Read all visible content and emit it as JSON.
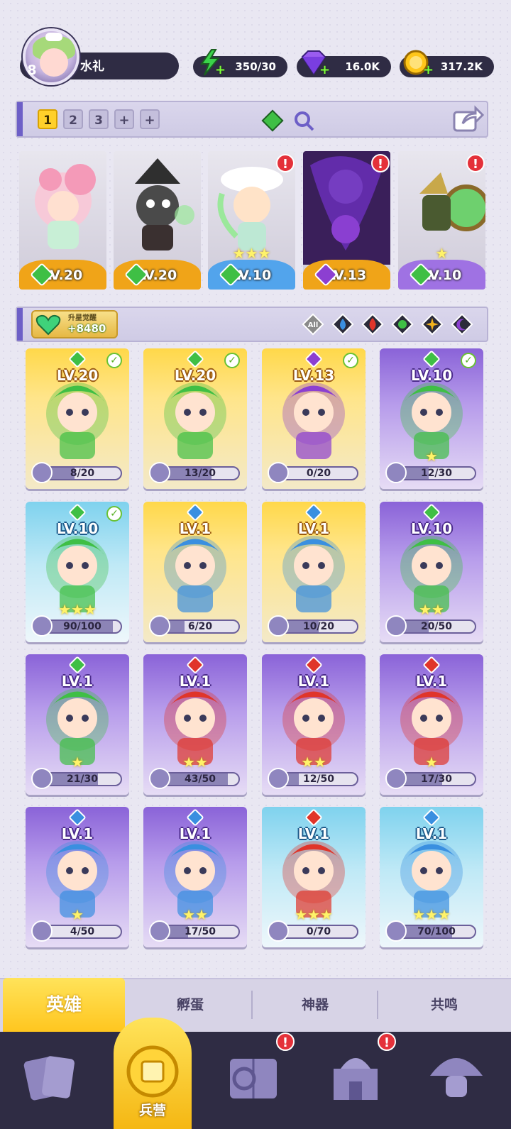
{
  "player": {
    "level": "8",
    "name": "水礼"
  },
  "resources": {
    "energy": "350/30",
    "gems": "16.0K",
    "gold": "317.2K"
  },
  "team": {
    "slots": [
      "1",
      "2",
      "3",
      "+",
      "+"
    ],
    "active_slot": "1",
    "heroes": [
      {
        "level": "LV.20",
        "element": "nature",
        "bar": "orange"
      },
      {
        "level": "LV.20",
        "element": "nature",
        "bar": "orange"
      },
      {
        "level": "LV.10",
        "element": "nature",
        "bar": "blue",
        "stars": 3,
        "alert": "!"
      },
      {
        "level": "LV.13",
        "element": "dark",
        "bar": "orange",
        "alert": "!"
      },
      {
        "level": "LV.10",
        "element": "nature",
        "bar": "purple",
        "stars": 1,
        "alert": "!"
      }
    ]
  },
  "filter": {
    "awaken_title": "升星觉醒",
    "awaken_value": "+8480",
    "chips": [
      "All",
      "water",
      "fire",
      "nature",
      "light",
      "dark"
    ],
    "all_label": "All"
  },
  "colors": {
    "nature": "#3fbf45",
    "water": "#3a8fe0",
    "fire": "#e0352a",
    "light": "#f2b21c",
    "dark": "#8c3fd1",
    "accent": "#ffcc22",
    "nav_bg": "#2f2c44"
  },
  "heroes": [
    {
      "level": "LV.20",
      "element": "nature",
      "frame": "gold",
      "progress": "8/20",
      "fill": 0.4,
      "owned": true,
      "stars": 0
    },
    {
      "level": "LV.20",
      "element": "nature",
      "frame": "gold",
      "progress": "13/20",
      "fill": 0.65,
      "owned": true,
      "stars": 0
    },
    {
      "level": "LV.13",
      "element": "dark",
      "frame": "gold",
      "progress": "0/20",
      "fill": 0.0,
      "owned": true,
      "stars": 0
    },
    {
      "level": "LV.10",
      "element": "nature",
      "frame": "purple",
      "progress": "12/30",
      "fill": 0.4,
      "owned": true,
      "stars": 1
    },
    {
      "level": "LV.10",
      "element": "nature",
      "frame": "cyan",
      "progress": "90/100",
      "fill": 0.9,
      "owned": true,
      "stars": 3
    },
    {
      "level": "LV.1",
      "element": "water",
      "frame": "gold",
      "progress": "6/20",
      "fill": 0.3,
      "owned": false,
      "stars": 0
    },
    {
      "level": "LV.1",
      "element": "water",
      "frame": "gold",
      "progress": "10/20",
      "fill": 0.5,
      "owned": false,
      "stars": 0
    },
    {
      "level": "LV.10",
      "element": "nature",
      "frame": "purple",
      "progress": "20/50",
      "fill": 0.4,
      "owned": false,
      "stars": 2
    },
    {
      "level": "LV.1",
      "element": "nature",
      "frame": "purple",
      "progress": "21/30",
      "fill": 0.7,
      "owned": false,
      "stars": 1
    },
    {
      "level": "LV.1",
      "element": "fire",
      "frame": "purple",
      "progress": "43/50",
      "fill": 0.86,
      "owned": false,
      "stars": 2
    },
    {
      "level": "LV.1",
      "element": "fire",
      "frame": "purple",
      "progress": "12/50",
      "fill": 0.24,
      "owned": false,
      "stars": 2
    },
    {
      "level": "LV.1",
      "element": "fire",
      "frame": "purple",
      "progress": "17/30",
      "fill": 0.57,
      "owned": false,
      "stars": 1
    },
    {
      "level": "LV.1",
      "element": "water",
      "frame": "purple",
      "progress": "4/50",
      "fill": 0.08,
      "owned": false,
      "stars": 1
    },
    {
      "level": "LV.1",
      "element": "water",
      "frame": "purple",
      "progress": "17/50",
      "fill": 0.34,
      "owned": false,
      "stars": 2
    },
    {
      "level": "LV.1",
      "element": "fire",
      "frame": "cyan",
      "progress": "0/70",
      "fill": 0.0,
      "owned": false,
      "stars": 3
    },
    {
      "level": "LV.1",
      "element": "water",
      "frame": "cyan",
      "progress": "70/100",
      "fill": 0.7,
      "owned": false,
      "stars": 3
    }
  ],
  "subtabs": [
    "英雄",
    "孵蛋",
    "神器",
    "共鸣"
  ],
  "bottom_nav": {
    "items": [
      "cards-icon",
      "barracks-icon",
      "spellbook-icon",
      "castle-icon",
      "mushroom-icon"
    ],
    "active_label": "兵营",
    "alerts": [
      "!",
      "!"
    ]
  }
}
